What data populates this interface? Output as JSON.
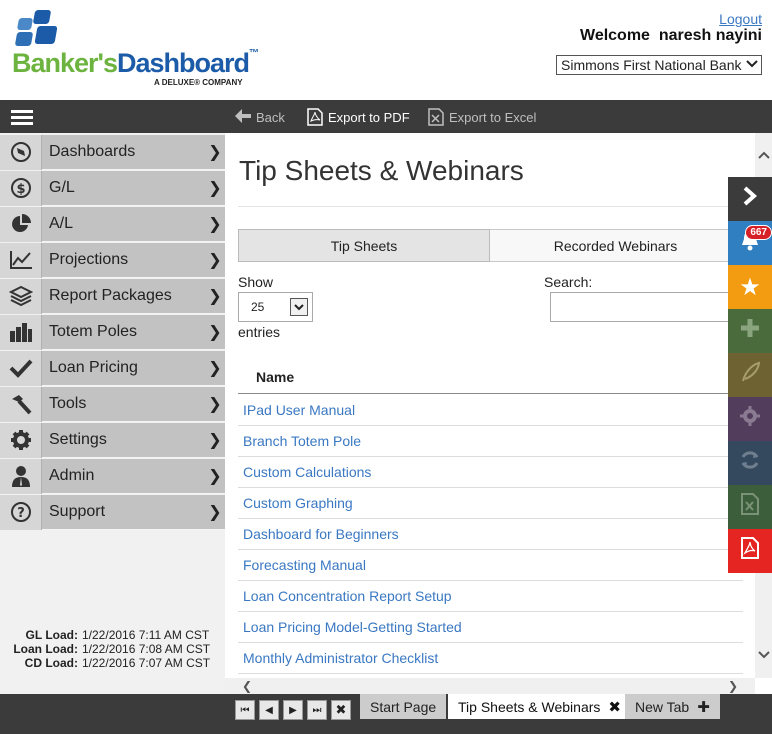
{
  "header": {
    "logo_part1": "Banker's",
    "logo_part2": "Dashboard",
    "logo_tm": "™",
    "logo_subtitle": "A DELUXE® COMPANY",
    "logout_label": "Logout",
    "welcome_prefix": "Welcome",
    "user_name": "naresh nayini",
    "bank_selected": "Simmons First National Bank",
    "colors": {
      "green": "#6cb33f",
      "blue": "#1b5ba8"
    }
  },
  "toolbar": {
    "back_label": "Back",
    "export_pdf_label": "Export to PDF",
    "export_excel_label": "Export to Excel"
  },
  "sidebar": {
    "items": [
      {
        "label": "Dashboards",
        "icon": "compass-icon"
      },
      {
        "label": "G/L",
        "icon": "dollar-icon"
      },
      {
        "label": "A/L",
        "icon": "pie-icon"
      },
      {
        "label": "Projections",
        "icon": "line-chart-icon"
      },
      {
        "label": "Report Packages",
        "icon": "layers-icon"
      },
      {
        "label": "Totem Poles",
        "icon": "bar-chart-icon"
      },
      {
        "label": "Loan Pricing",
        "icon": "check-icon"
      },
      {
        "label": "Tools",
        "icon": "hammer-icon"
      },
      {
        "label": "Settings",
        "icon": "gear-icon"
      },
      {
        "label": "Admin",
        "icon": "user-icon"
      },
      {
        "label": "Support",
        "icon": "question-icon"
      }
    ],
    "loads": [
      {
        "key": "GL Load:",
        "value": "1/22/2016 7:11 AM CST"
      },
      {
        "key": "Loan Load:",
        "value": "1/22/2016 7:08 AM CST"
      },
      {
        "key": "CD Load:",
        "value": "1/22/2016 7:07 AM CST"
      }
    ]
  },
  "main": {
    "title": "Tip Sheets & Webinars",
    "tabs": [
      {
        "label": "Tip Sheets",
        "active": true
      },
      {
        "label": "Recorded Webinars",
        "active": false
      }
    ],
    "show_label": "Show",
    "page_length": "25",
    "entries_label": "entries",
    "search_label": "Search:",
    "search_value": "",
    "table": {
      "header": "Name",
      "rows": [
        "IPad User Manual",
        "Branch Totem Pole",
        "Custom Calculations",
        "Custom Graphing",
        "Dashboard for Beginners",
        "Forecasting Manual",
        "Loan Concentration Report Setup",
        "Loan Pricing Model-Getting Started",
        "Monthly Administrator Checklist"
      ]
    }
  },
  "rail": {
    "notification_count": "667",
    "buttons": [
      {
        "icon": "chevron-right-icon",
        "color": "#3b3b3b"
      },
      {
        "icon": "bell-icon",
        "color": "#2f7fc1"
      },
      {
        "icon": "star-icon",
        "color": "#f39c12"
      },
      {
        "icon": "plus-icon",
        "color": "#4a6b3c"
      },
      {
        "icon": "feather-icon",
        "color": "#6e6233"
      },
      {
        "icon": "gear-icon",
        "color": "#523d5c"
      },
      {
        "icon": "refresh-icon",
        "color": "#34495e"
      },
      {
        "icon": "excel-icon",
        "color": "#3d5e3a"
      },
      {
        "icon": "pdf-icon",
        "color": "#e52521"
      }
    ]
  },
  "bottom": {
    "tabs": [
      {
        "label": "Start Page"
      },
      {
        "label": "Tip Sheets & Webinars",
        "close": "✖"
      },
      {
        "label": "New Tab",
        "add": "✚"
      }
    ]
  }
}
